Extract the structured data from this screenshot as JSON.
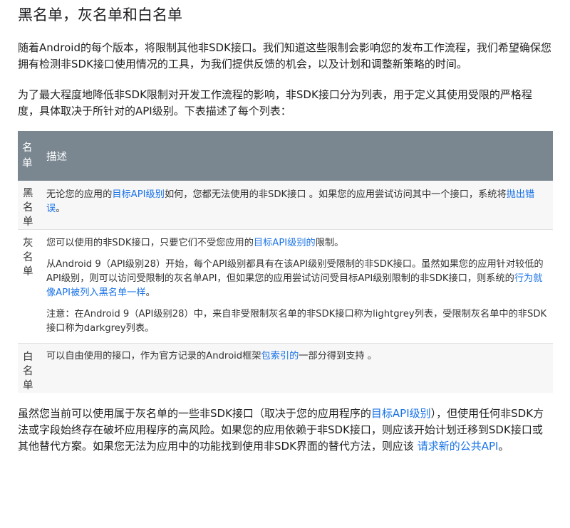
{
  "title": "黑名单，灰名单和白名单",
  "intro_1": "随着Android的每个版本，将限制其他非SDK接口。我们知道这些限制会影响您的发布工作流程，我们希望确保您拥有检测非SDK接口使用情况的工具，为我们提供反馈的机会，以及计划和调整新策略的时间。",
  "intro_2": "为了最大程度地降低非SDK限制对开发工作流程的影响，非SDK接口分为列表，用于定义其使用受限的严格程度，具体取决于所针对的API级别。下表描述了每个列表：",
  "table": {
    "header_name": "名单",
    "header_desc": "描述",
    "blacklist": {
      "name": "黑名单",
      "desc_before": "无论您的应用的",
      "link_1": "目标API级别",
      "desc_middle": "如何，您都无法使用的非SDK接口 。如果您的应用尝试访问其中一个接口，系统将",
      "link_2": "抛出错误",
      "desc_after": "。"
    },
    "greylist": {
      "name": "灰名单",
      "p1_before": "您可以使用的非SDK接口，只要它们不受您应用的",
      "p1_link": "目标API级别的",
      "p1_after": "限制。",
      "p2_before": "从Android 9（API级别28）开始，每个API级别都具有在该API级别受限制的非SDK接口。虽然如果您的应用针对较低的API级别，则可以访问受限制的灰名单API，但如果您的应用尝试访问受目标API级别限制的非SDK接口，则系统的",
      "p2_link": "行为就像API被列入黑名单一样",
      "p2_after": "。",
      "p3": "注意：在Android 9（API级别28）中，来自非受限制灰名单的非SDK接口称为lightgrey列表，受限制灰名单中的非SDK接口称为darkgrey列表。"
    },
    "whitelist": {
      "name": "白名单",
      "desc_before": "可以自由使用的接口，作为官方记录的Android框架",
      "link": "包索引的",
      "desc_after": "一部分得到支持 。"
    }
  },
  "outro": {
    "before": "虽然您当前可以使用属于灰名单的一些非SDK接口（取决于您的应用程序的",
    "link_1": "目标API级别",
    "middle": "），但使用任何非SDK方法或字段始终存在破坏应用程序的高风险。如果您的应用依赖于非SDK接口，则应该开始计划迁移到SDK接口或其他替代方案。如果您无法为应用中的功能找到使用非SDK界面的替代方法，则应该 ",
    "link_2": "请求新的公共API",
    "after": "。"
  },
  "colors": {
    "link": "#1a73e8",
    "table_header_bg": "#7a8791",
    "row_alt_bg": "#f7f7f7"
  }
}
